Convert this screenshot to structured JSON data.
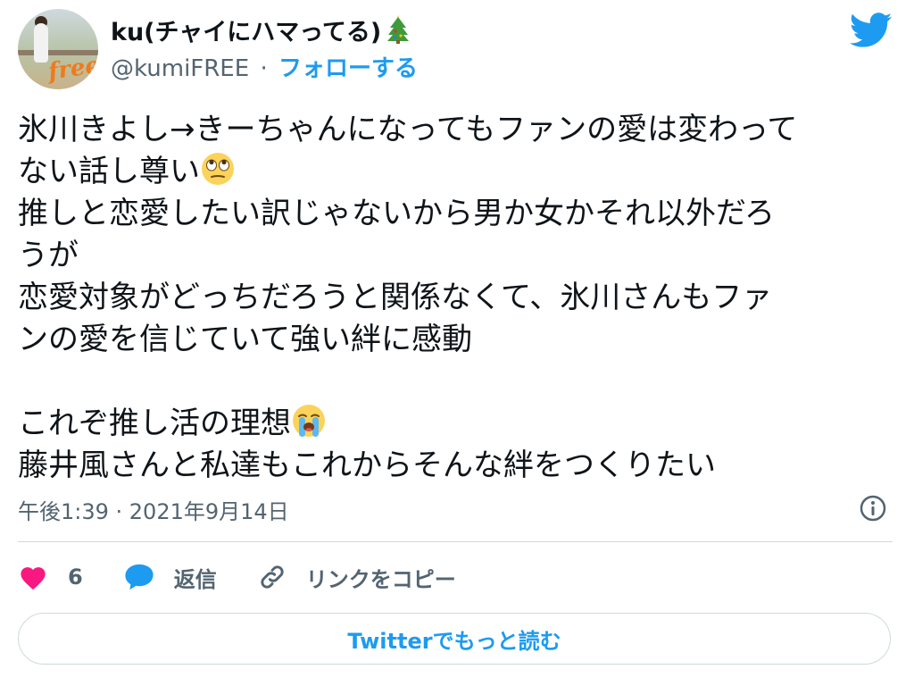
{
  "user": {
    "display_name": "ku(チャイにハマってる)",
    "display_emoji": "christmas-tree-icon",
    "handle": "@kumiFREE",
    "separator": "·",
    "follow_label": "フォローする"
  },
  "tweet": {
    "lines": [
      "氷川きよし→きーちゃんになってもファンの愛は変わって",
      "ない話し尊い",
      "推しと恋愛したい訳じゃないから男か女かそれ以外だろ",
      "うが",
      "恋愛対象がどっちだろうと関係なくて、氷川さんもファ",
      "ンの愛を信じていて強い絆に感動",
      "",
      "これぞ推し活の理想",
      "藤井風さんと私達もこれからそんな絆をつくりたい"
    ],
    "emoji_1": "face-with-rolling-eyes-emoji",
    "emoji_2": "loudly-crying-face-emoji",
    "timestamp": "午後1:39 · 2021年9月14日"
  },
  "actions": {
    "like_count": "6",
    "reply_label": "返信",
    "copy_link_label": "リンクをコピー"
  },
  "read_more_label": "Twitterでもっと読む",
  "colors": {
    "accent": "#1d9bf0",
    "like": "#f91880",
    "text": "#0f1419",
    "secondary": "#536471",
    "border": "#cfd9de"
  }
}
